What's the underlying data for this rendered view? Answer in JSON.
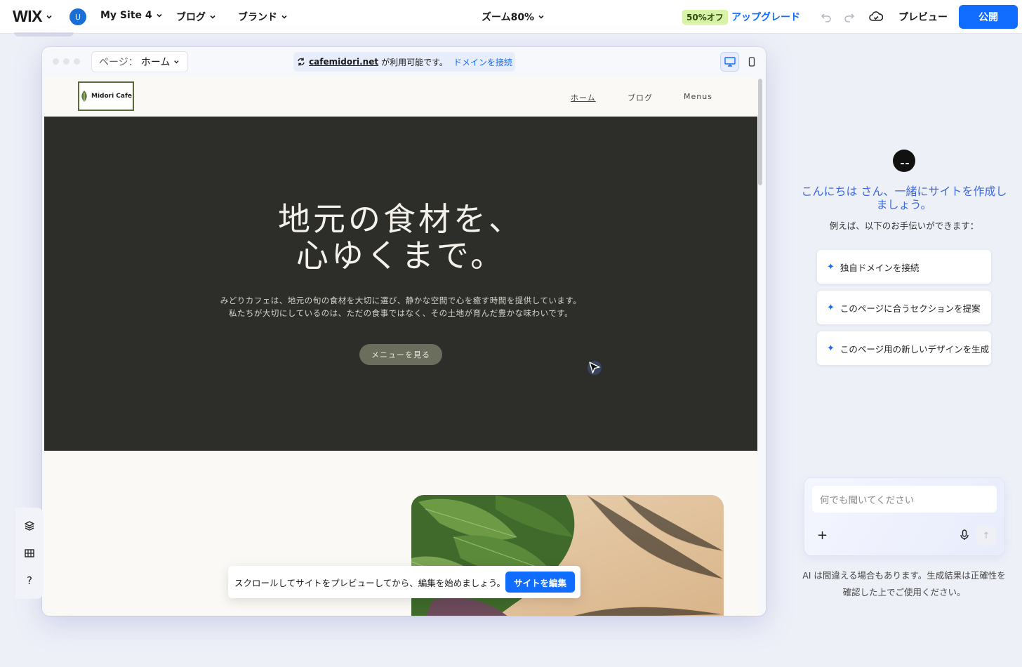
{
  "topbar": {
    "logo": "WIX",
    "avatar_initial": "U",
    "site_name": "My Site 4",
    "blog_menu": "ブログ",
    "brand_menu": "ブランド",
    "zoom_label": "ズーム80%",
    "discount_badge": "50%オフ",
    "upgrade_label": "アップグレード",
    "preview_label": "プレビュー",
    "publish_label": "公開"
  },
  "frame": {
    "page_label": "ページ：",
    "page_value": "ホーム",
    "domain": "cafemidori.net",
    "domain_available": "が利用可能です。",
    "domain_connect": "ドメインを接続"
  },
  "site": {
    "logo_text": "Midori Cafe",
    "nav": [
      "ホーム",
      "ブログ",
      "Menus"
    ],
    "hero_title_line1": "地元の食材を、",
    "hero_title_line2": "心ゆくまで。",
    "hero_desc": "みどりカフェは、地元の旬の食材を大切に選び、静かな空間で心を癒す時間を提供しています。私たちが大切にしているのは、ただの食事ではなく、その土地が育んだ豊かな味わいです。",
    "hero_button": "メニューを見る"
  },
  "toast": {
    "text": "スクロールしてサイトをプレビューしてから、編集を始めましょう。",
    "button": "サイトを編集"
  },
  "left_tools": {
    "help": "?"
  },
  "ai_panel": {
    "greeting": "こんにちは さん、一緒にサイトを作成しましょう。",
    "subtitle": "例えば、以下のお手伝いができます：",
    "suggestions": [
      "独自ドメインを接続",
      "このページに合うセクションを提案",
      "このページ用の新しいデザインを生成"
    ],
    "input_placeholder": "何でも聞いてください",
    "disclaimer": "AI は間違える場合もあります。生成結果は正確性を確認した上でご使用ください。"
  },
  "colors": {
    "accent": "#116dff",
    "hero_bg": "#2d2e2a",
    "discount_bg": "#d8f3a8",
    "greeting": "#3e6ae0"
  }
}
